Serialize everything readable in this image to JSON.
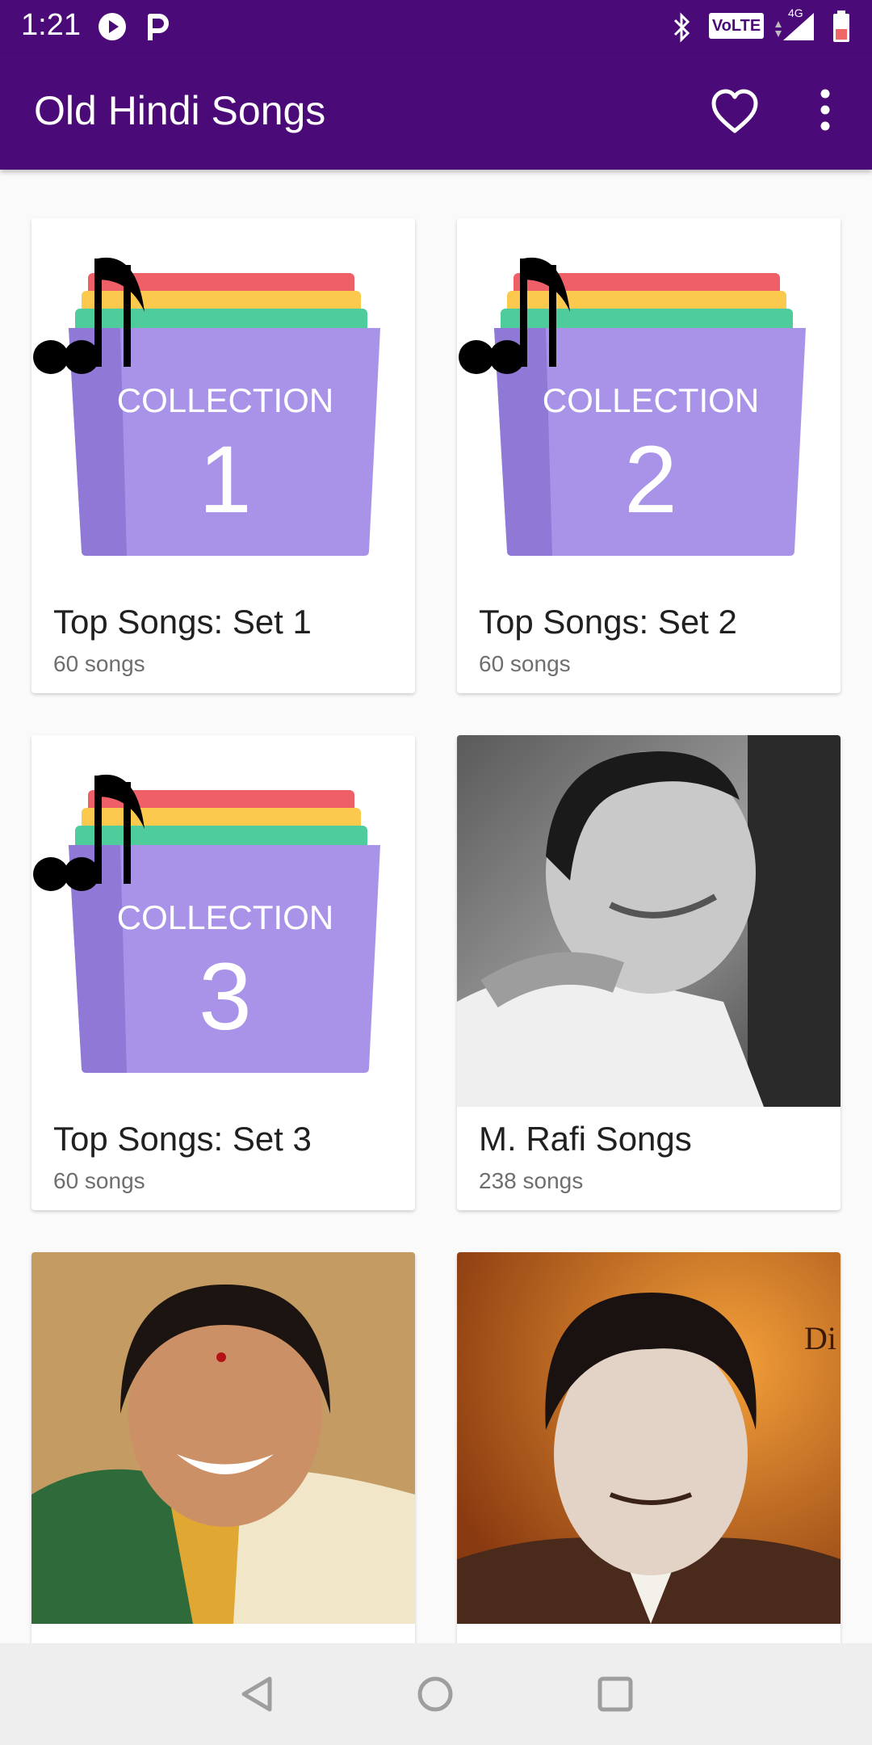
{
  "status_bar": {
    "time": "1:21",
    "icons": [
      "play-circle-icon",
      "parking-app-icon",
      "bluetooth-icon",
      "volte-icon",
      "signal-4g-icon",
      "battery-icon"
    ],
    "volte_label": "VoLTE",
    "network_label": "4G"
  },
  "app_bar": {
    "title": "Old Hindi Songs",
    "favorite_icon": "heart-outline-icon",
    "menu_icon": "more-vert-icon",
    "background_color": "#4a0a78"
  },
  "collections": [
    {
      "title": "Top Songs: Set 1",
      "subtitle": "60 songs",
      "art_label": "COLLECTION",
      "art_number": "1"
    },
    {
      "title": "Top Songs: Set 2",
      "subtitle": "60 songs",
      "art_label": "COLLECTION",
      "art_number": "2"
    },
    {
      "title": "Top Songs: Set 3",
      "subtitle": "60 songs",
      "art_label": "COLLECTION",
      "art_number": "3"
    },
    {
      "title": "M. Rafi Songs",
      "subtitle": "238 songs"
    },
    {
      "title": "",
      "subtitle": ""
    },
    {
      "title": "",
      "subtitle": "",
      "photo_text": "Di"
    }
  ],
  "nav_bar": {
    "icons": [
      "back-icon",
      "home-icon",
      "recents-icon"
    ]
  }
}
